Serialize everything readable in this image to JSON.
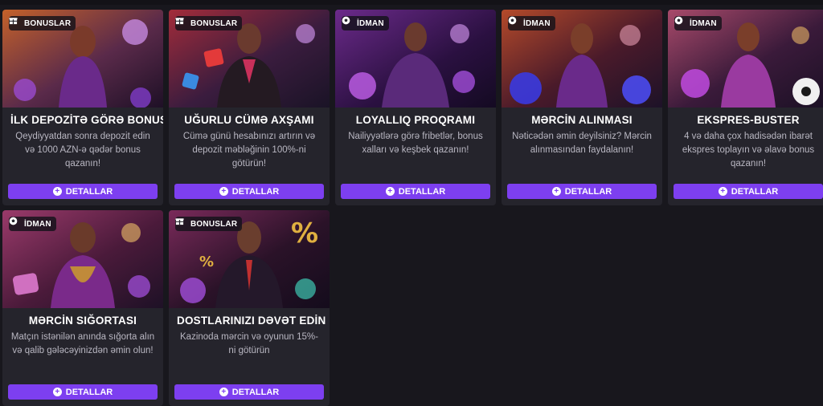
{
  "cards": [
    {
      "tag": "BONUSLAR",
      "tag_icon": "gift-icon",
      "title": "İLK DEPOZİTƏ GÖRƏ BONUS",
      "desc": "Qeydiyyatdan sonra depozit edin və 1000 AZN-ə qədər bonus qazanın!",
      "button": "DETALLAR",
      "colors": [
        "#6a2a1a",
        "#c4612a",
        "#2b1430"
      ]
    },
    {
      "tag": "BONUSLAR",
      "tag_icon": "gift-icon",
      "title": "UĞURLU CÜMƏ AXŞAMI",
      "desc": "Cümə günü hesabınızı artırın və depozit məbləğinin 100%-ni götürün!",
      "button": "DETALLAR",
      "colors": [
        "#3a1c3e",
        "#a32c3a",
        "#1a1326"
      ]
    },
    {
      "tag": "İDMAN",
      "tag_icon": "soccer-ball-icon",
      "title": "LOYALLIQ PROQRAMI",
      "desc": "Nailiyyətlərə görə fribetlər, bonus xalları və keşbek qazanın!",
      "button": "DETALLAR",
      "colors": [
        "#2a1040",
        "#6b2a8a",
        "#140a22"
      ]
    },
    {
      "tag": "İDMAN",
      "tag_icon": "soccer-ball-icon",
      "title": "MƏRCİN ALINMASI",
      "desc": "Nəticədən əmin deyilsiniz? Mərcin alınmasından faydalanın!",
      "button": "DETALLAR",
      "colors": [
        "#4a1a2a",
        "#b44a2a",
        "#1d1228"
      ]
    },
    {
      "tag": "İDMAN",
      "tag_icon": "soccer-ball-icon",
      "title": "EKSPRES-BUSTER",
      "desc": "4 və daha çox hadisədən ibarət ekspres toplayın və əlavə bonus qazanın!",
      "button": "DETALLAR",
      "colors": [
        "#3a1a3a",
        "#a84a6a",
        "#1a1024"
      ]
    },
    {
      "tag": "İDMAN",
      "tag_icon": "soccer-ball-icon",
      "title": "MƏRCİN SIĞORTASI",
      "desc": "Matçın istənilən anında sığorta alın və qalib gələcəyinizdən əmin olun!",
      "button": "DETALLAR",
      "colors": [
        "#4a1a3a",
        "#9a3a6a",
        "#1e1126"
      ]
    },
    {
      "tag": "BONUSLAR",
      "tag_icon": "gift-icon",
      "title": "DOSTLARINIZI DƏVƏT EDİN",
      "desc": "Kazinoda mərcin və oyunun 15%-ni götürün",
      "button": "DETALLAR",
      "colors": [
        "#2a1228",
        "#7a2a5a",
        "#140c1c"
      ]
    }
  ]
}
